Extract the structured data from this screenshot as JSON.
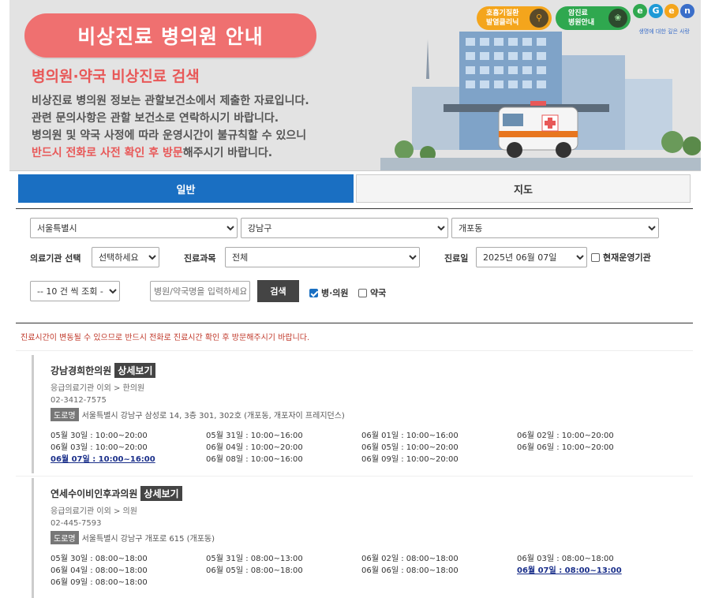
{
  "banner": {
    "title": "비상진료 병의원 안내",
    "subtitle": "병의원·약국 비상진료 검색",
    "desc_line1": "비상진료 병의원 정보는 관할보건소에서 제출한 자료입니다.",
    "desc_line2": "관련 문의사항은 관할 보건소로 연락하시기 바랍니다.",
    "desc_line3": "병의원 및 약국 사정에 따라 운영시간이 불규칙할 수 있으니",
    "desc_line4_highlight": "반드시 전화로 사전 확인 후 방문",
    "desc_line4_rest": "해주시기 바랍니다.",
    "badge_resp_line1": "호흡기질환",
    "badge_resp_line2": "발열클리닉",
    "badge_cancer_line1": "암진료",
    "badge_cancer_line2": "병원안내",
    "egen_letters": [
      "e",
      "G",
      "e",
      "n"
    ],
    "egen_tagline": "생명에 대한 깊은 사랑"
  },
  "tabs": {
    "general": "일반",
    "map": "지도"
  },
  "filters": {
    "sido": "서울특별시",
    "sigungu": "강남구",
    "dong": "개포동",
    "institution_label": "의료기관 선택",
    "institution_value": "선택하세요",
    "department_label": "진료과목",
    "department_value": "전체",
    "date_label": "진료일",
    "date_value": "2025년 06월 07일",
    "open_now_label": "현재운영기관",
    "page_size": "-- 10 건 씩 조회 --",
    "search_placeholder": "병원/약국명을 입력하세요",
    "search_button": "검색",
    "hospital_check": "병·의원",
    "pharmacy_check": "약국"
  },
  "notice": "진료시간이 변동될 수 있으므로 반드시 전화로 진료시간 확인 후 방문해주시기 바랍니다.",
  "results": [
    {
      "name": "강남경희한의원",
      "detail": "상세보기",
      "type": "응급의료기관 이외 > 한의원",
      "phone": "02-3412-7575",
      "road_tag": "도로명",
      "address": "서울특별시 강남구 삼성로 14, 3층 301, 302호 (개포동, 개포자이 프레지던스)",
      "hours": [
        "05월 30일 : 10:00~20:00",
        "05월 31일 : 10:00~16:00",
        "06월 01일 : 10:00~16:00",
        "06월 02일 : 10:00~20:00",
        "06월 03일 : 10:00~20:00",
        "06월 04일 : 10:00~20:00",
        "06월 05일 : 10:00~20:00",
        "06월 06일 : 10:00~20:00",
        "06월 07일 : 10:00~16:00",
        "06월 08일 : 10:00~16:00",
        "06월 09일 : 10:00~20:00"
      ],
      "today_index": 8
    },
    {
      "name": "연세수이비인후과의원",
      "detail": "상세보기",
      "type": "응급의료기관 이외 > 의원",
      "phone": "02-445-7593",
      "road_tag": "도로명",
      "address": "서울특별시 강남구 개포로 615 (개포동)",
      "hours": [
        "05월 30일 : 08:00~18:00",
        "05월 31일 : 08:00~13:00",
        "06월 02일 : 08:00~18:00",
        "06월 03일 : 08:00~18:00",
        "06월 04일 : 08:00~18:00",
        "06월 05일 : 08:00~18:00",
        "06월 06일 : 08:00~18:00",
        "06월 07일 : 08:00~13:00",
        "06월 09일 : 08:00~18:00"
      ],
      "today_index": 7
    }
  ],
  "colors": {
    "accent_blue": "#1a6fc2",
    "banner_red": "#ef7070",
    "notice_red": "#c0392b",
    "today_blue": "#1a2f8a"
  }
}
